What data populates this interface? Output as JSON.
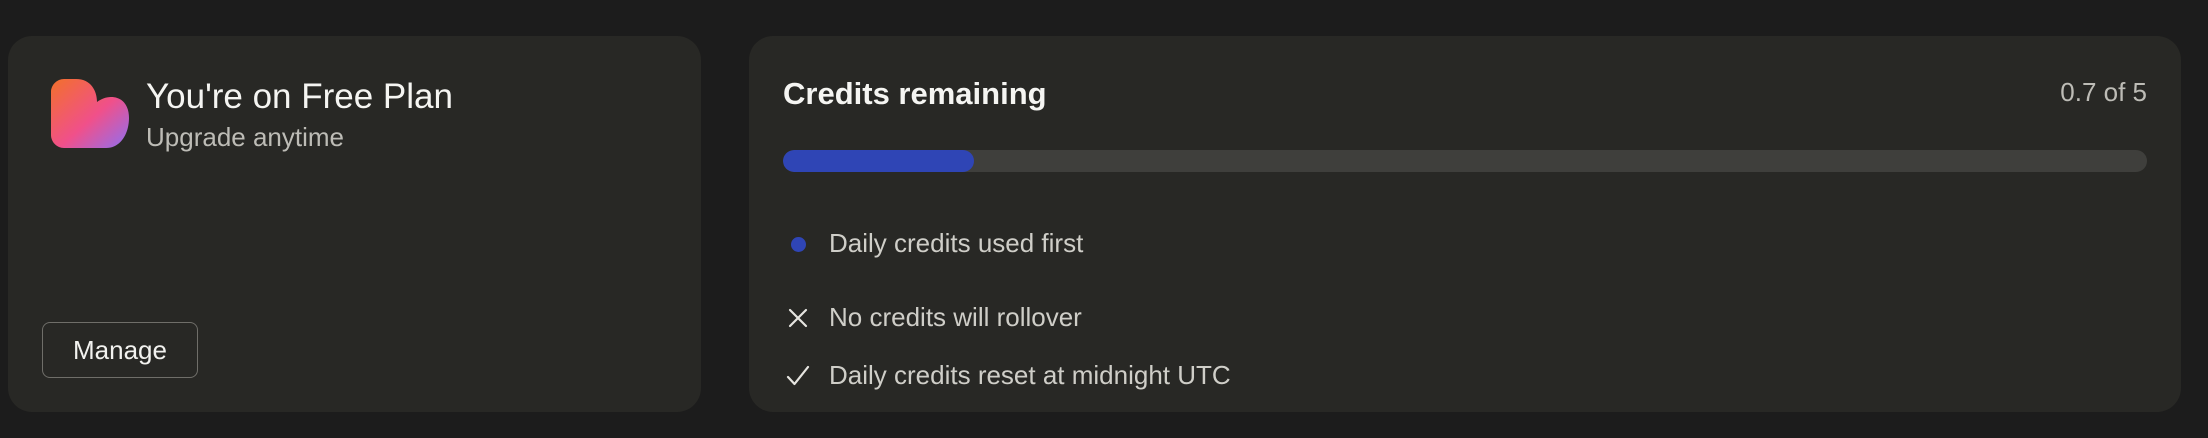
{
  "plan": {
    "title": "You're on Free Plan",
    "subtitle": "Upgrade anytime",
    "logo_icon": "heart-logo-icon",
    "manage_label": "Manage"
  },
  "credits": {
    "title": "Credits remaining",
    "count_text": "0.7 of 5",
    "progress_fraction": 0.14,
    "features": [
      {
        "icon": "blue-dot-icon",
        "text": "Daily credits used first"
      },
      {
        "icon": "x-mark-icon",
        "text": "No credits will rollover"
      },
      {
        "icon": "checkmark-icon",
        "text": "Daily credits reset at midnight UTC"
      }
    ]
  },
  "colors": {
    "page_background": "#1c1c1c",
    "card_background": "#282825",
    "progress_fill": "#2f45b5",
    "progress_track": "#3f3f3c",
    "dot": "#2f45b5",
    "logo_gradient": [
      "#f3702b",
      "#f0508a",
      "#8f6ff2"
    ]
  }
}
